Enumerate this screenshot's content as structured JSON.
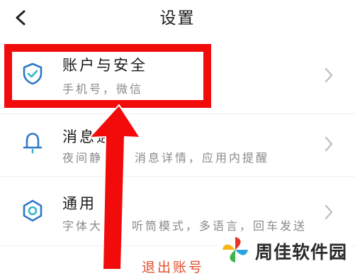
{
  "header": {
    "title": "设置",
    "back_icon": "chevron-left-icon"
  },
  "settings": [
    {
      "title": "账户与安全",
      "subtitle": "手机号，微信",
      "icon": "shield-check-icon"
    },
    {
      "title": "消息通",
      "subtitle": "夜间静",
      "subtitle_tail": "，消息详情，应用内提醒",
      "icon": "bell-icon"
    },
    {
      "title": "通用",
      "subtitle": "字体大",
      "subtitle_tail": "，听筒模式，多语言，回车发送",
      "icon": "gear-icon"
    }
  ],
  "logout_label": "退出账号",
  "watermark": {
    "text": "周佳软件园",
    "logo_icon": "pinwheel-logo-icon"
  },
  "colors": {
    "accent_blue": "#2f78c9",
    "highlight_red": "#f20b0b",
    "logout": "#e24d2b",
    "subtitle_gray": "#8a8a8a"
  }
}
